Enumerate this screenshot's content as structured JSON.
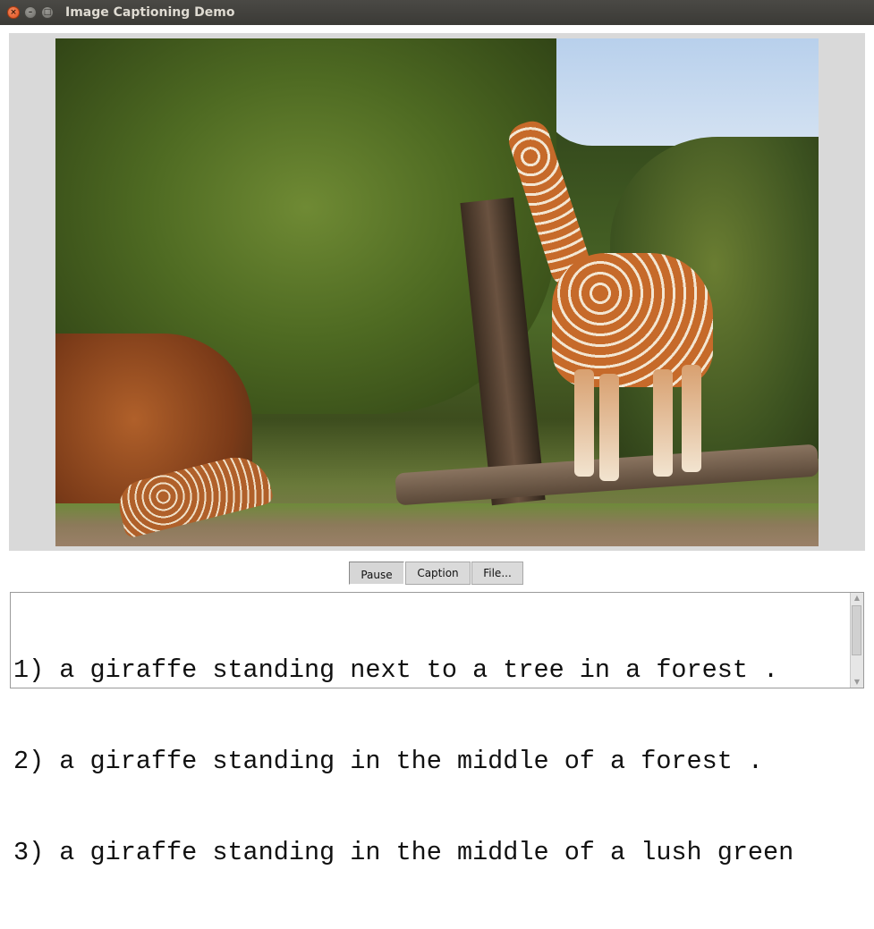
{
  "window": {
    "title": "Image Captioning Demo",
    "controls": {
      "close": "close-icon",
      "minimize": "minimize-icon",
      "maximize": "maximize-icon"
    }
  },
  "image": {
    "description": "Two giraffes in a forested enclosure; one tall giraffe eating from a tree, another lying near a log"
  },
  "toolbar": {
    "pause_label": "Pause",
    "caption_label": "Caption",
    "file_label": "File..."
  },
  "captions": [
    "1) a giraffe standing next to a tree in a forest .",
    "2) a giraffe standing in the middle of a forest .",
    "3) a giraffe standing in the middle of a lush green"
  ],
  "colors": {
    "titlebar": "#3c3b37",
    "panel_bg": "#d9d9d9",
    "close_button": "#e0501f"
  }
}
